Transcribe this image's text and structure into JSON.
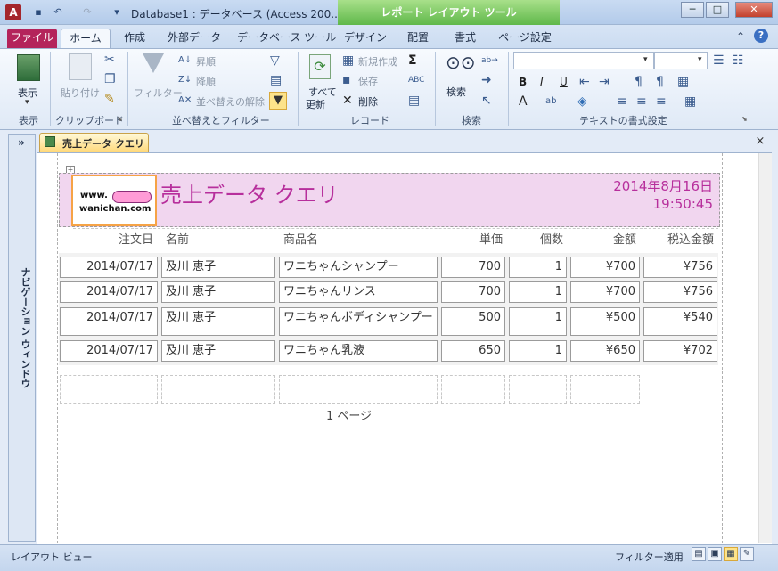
{
  "window": {
    "title": "Database1 : データベース (Access 200...",
    "context_tab": "レポート レイアウト ツール",
    "min": "─",
    "max": "□",
    "close": "✕"
  },
  "ribbon_tabs": [
    "ファイル",
    "ホーム",
    "作成",
    "外部データ",
    "データベース ツール",
    "デザイン",
    "配置",
    "書式",
    "ページ設定"
  ],
  "ribbon": {
    "groups": [
      "表示",
      "クリップボード",
      "並べ替えとフィルター",
      "レコード",
      "検索",
      "テキストの書式設定"
    ],
    "view": "表示",
    "paste": "貼り付け",
    "filter": "フィルター",
    "asc": "昇順",
    "desc": "降順",
    "clear_sort": "並べ替えの解除",
    "refresh_all_1": "すべて",
    "refresh_all_2": "更新",
    "new": "新規作成",
    "save": "保存",
    "delete": "削除",
    "find": "検索",
    "bold": "B",
    "italic": "I",
    "underline": "U"
  },
  "nav": {
    "label": "ナビゲーション ウィンドウ",
    "toggle": "»"
  },
  "doc_tab": {
    "label": "売上データ クエリ",
    "close": "×"
  },
  "report": {
    "logo_line1": "www.",
    "logo_line2": "wanichan.com",
    "title": "売上データ クエリ",
    "date": "2014年8月16日",
    "time": "19:50:45",
    "columns": [
      "注文日",
      "名前",
      "商品名",
      "単価",
      "個数",
      "金額",
      "税込金額"
    ],
    "rows": [
      [
        "2014/07/17",
        "及川 恵子",
        "ワニちゃんシャンプー",
        "700",
        "1",
        "¥700",
        "¥756"
      ],
      [
        "2014/07/17",
        "及川 恵子",
        "ワニちゃんリンス",
        "700",
        "1",
        "¥700",
        "¥756"
      ],
      [
        "2014/07/17",
        "及川 恵子",
        "ワニちゃんボディシャンプー",
        "500",
        "1",
        "¥500",
        "¥540"
      ],
      [
        "2014/07/17",
        "及川 恵子",
        "ワニちゃん乳液",
        "650",
        "1",
        "¥650",
        "¥702"
      ]
    ],
    "page_footer": "1 ページ"
  },
  "status": {
    "view": "レイアウト ビュー",
    "filter": "フィルター適用"
  }
}
